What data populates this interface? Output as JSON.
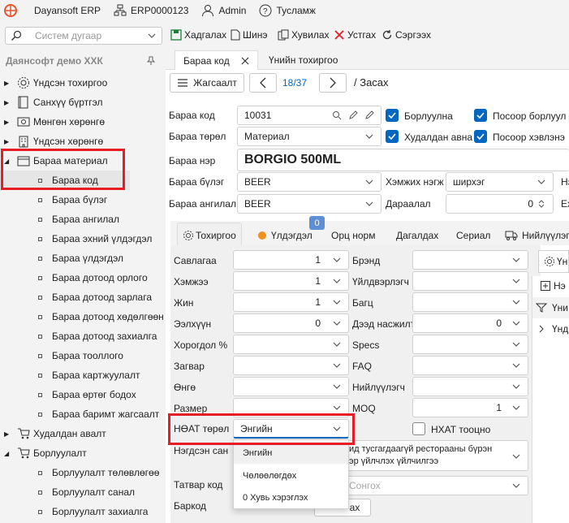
{
  "topbar": {
    "app": "Dayansoft ERP",
    "erp": "ERP0000123",
    "user": "Admin",
    "help": "Тусламж"
  },
  "toolbar": {
    "search_placeholder": "Систем дугаар",
    "save": "Хадгалах",
    "new": "Шинэ",
    "copy": "Хувилах",
    "delete": "Устгах",
    "refresh": "Сэргээх"
  },
  "sidebar": {
    "company": "Даянсофт демо ХХК",
    "top": [
      "Үндсэн тохиргоо",
      "Санхүү бүртгэл",
      "Мөнгөн хөрөнгө",
      "Үндсэн хөрөнгө"
    ],
    "open": "Бараа материал",
    "children": [
      "Бараа код",
      "Бараа бүлэг",
      "Бараа ангилал",
      "Бараа эхний үлдэгдэл",
      "Бараа үлдэгдэл",
      "Бараа дотоод орлого",
      "Бараа дотоод зарлага",
      "Бараа дотоод хөдөлгөөн",
      "Бараа дотоод захиалга",
      "Бараа тооллого",
      "Бараа картжуулалт",
      "Бараа өртөг бодох",
      "Бараа баримт жагсаалт"
    ],
    "sales": "Худалдан авалт",
    "sales2": "Борлуулалт",
    "sales_children": [
      "Борлуулалт төлөвлөгөө",
      "Борлуулалт санал",
      "Борлуулалт захиалга"
    ]
  },
  "tabs": [
    "Бараа код",
    "Үнийн тохиргоо"
  ],
  "nav": {
    "list": "Жагсаалт",
    "counter": "18/37",
    "edit": "/ Засах"
  },
  "form": {
    "code_label": "Бараа код",
    "code_value": "10031",
    "type_label": "Бараа төрөл",
    "type_value": "Материал",
    "name_label": "Бараа нэр",
    "name_value": "BORGIO 500ML",
    "group_label": "Бараа бүлэг",
    "group_value": "BEER",
    "class_label": "Бараа ангилал",
    "class_value": "BEER",
    "unit_label": "Хэмжих нэгж",
    "unit_value": "ширхэг",
    "order_label": "Дараалал",
    "order_value": "0",
    "cb_sold": "Борлуулна",
    "cb_pos_sold": "Посоор борлуул",
    "cb_bought": "Худалдан авна",
    "cb_pos_use": "Посоор хэвлэнэ",
    "cut1": "Нэ",
    "cut2": "Ех"
  },
  "subtabs": {
    "settings": "Тохиргоо",
    "balance": "Үлдэгдэл",
    "badge": "0",
    "norm": "Орц норм",
    "extra": "Дагалдах",
    "serial": "Сериал",
    "supplier": "Нийлүүлэгч"
  },
  "props": {
    "pack": "Савлагаа",
    "pack_v": "1",
    "volume": "Хэмжээ",
    "volume_v": "1",
    "weight": "Жин",
    "weight_v": "1",
    "capacity": "Ээлхүүн",
    "capacity_v": "0",
    "discount": "Хорогдол %",
    "model": "Загвар",
    "color": "Өнгө",
    "size": "Размер",
    "vat": "НӨАТ төрөл",
    "vat_v": "Энгийн",
    "unit_sale": "Нэгдсэн сан",
    "tax_code": "Татвар код",
    "tax_placeholder": "Сонгох",
    "barcode": "Баркод",
    "barcode_btn": "ах",
    "brand": "Брэнд",
    "maker": "Үйлдвэрлэгч",
    "batch": "Багц",
    "top_order": "Дээд насжилт",
    "top_order_v": "0",
    "specs": "Specs",
    "faq": "FAQ",
    "supplier": "Нийлүүлэгч",
    "moq": "MOQ",
    "moq_v": "1",
    "nhat": "НХАТ тооцно",
    "restaurant": "Нийтийн хоолны үйлчилгээ / зад тусгайлагдаагүй ресторанын бүрэн үйлчилгээ / хоол хүргэх үйлчилгээ",
    "restaurant_short1": "ид тусгагдаагүй ресторааны бүрэн",
    "restaurant_short2": "эр үйлчлэх үйлчилгээ",
    "right_cut1": "Үн",
    "right_cut2": "Нэ",
    "right_cut3": "Үни",
    "right_cut4": "Үнд"
  },
  "dropdown": [
    "Энгийн",
    "Чөлөөлөгдөх",
    "0 Хувь хэрэглэх"
  ]
}
